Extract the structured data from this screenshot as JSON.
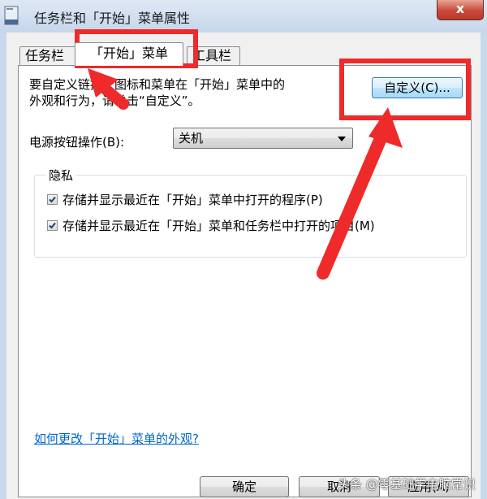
{
  "window": {
    "title": "任务栏和「开始」菜单属性",
    "close_label": "x"
  },
  "tabs": [
    {
      "label": "任务栏",
      "active": false
    },
    {
      "label": "「开始」菜单",
      "active": true
    },
    {
      "label": "工具栏",
      "active": false
    }
  ],
  "start_menu": {
    "description_line1": "要自定义链接、图标和菜单在「开始」菜单中的",
    "description_line2": "外观和行为，请单击“自定义”。",
    "customize_label": "自定义(C)...",
    "power_label": "电源按钮操作(B):",
    "power_value": "关机",
    "privacy": {
      "legend": "隐私",
      "items": [
        {
          "label": "存储并显示最近在「开始」菜单中打开的程序(P)",
          "checked": true
        },
        {
          "label": "存储并显示最近在「开始」菜单和任务栏中打开的项目(M)",
          "checked": true
        }
      ]
    },
    "help_link": "如何更改「开始」菜单的外观?"
  },
  "buttons": {
    "ok": "确定",
    "cancel": "取消",
    "apply": "应用(A)"
  },
  "watermark": "头条 @零基础学电脑常识",
  "colors": {
    "highlight": "#ef2a2a",
    "link": "#0066cc",
    "accent_button": "#3c7fb1"
  }
}
